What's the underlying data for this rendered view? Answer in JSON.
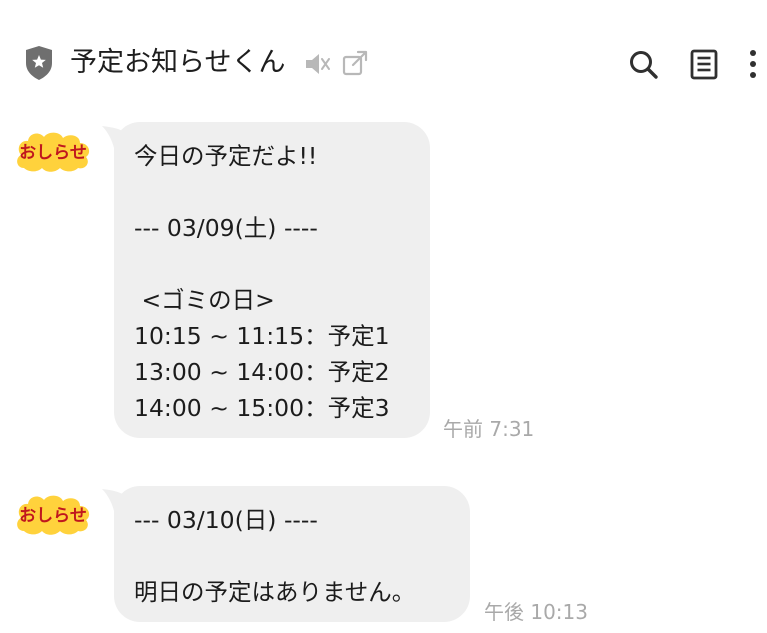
{
  "header": {
    "title": "予定お知らせくん",
    "icons": [
      "shield-star-icon",
      "mute-icon",
      "external-link-icon",
      "search-icon",
      "note-icon",
      "more-vertical-icon"
    ]
  },
  "messages": [
    {
      "sender_badge": "おしらせ",
      "lines": [
        "今日の予定だよ!!",
        "",
        "--- 03/09(土) ----",
        "",
        " <ゴミの日>",
        "10:15 ~ 11:15：予定1",
        "13:00 ~ 14:00：予定2",
        "14:00 ~ 15:00：予定3"
      ],
      "time": "午前 7:31"
    },
    {
      "sender_badge": "おしらせ",
      "lines": [
        "--- 03/10(日) ----",
        "",
        "明日の予定はありません。"
      ],
      "time": "午後 10:13"
    }
  ],
  "colors": {
    "bubble": "#efefef",
    "badge_fill": "#ffd23c",
    "badge_text": "#c0171e",
    "time": "#a9a9a9",
    "header_icon": "#303030",
    "muted_icon": "#b5b5b5"
  }
}
